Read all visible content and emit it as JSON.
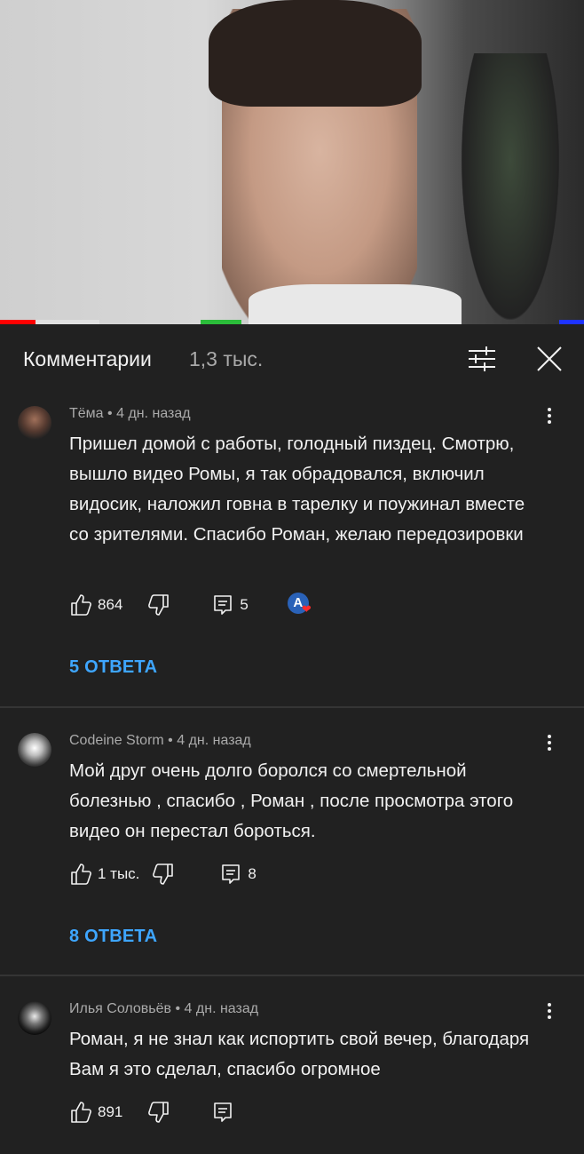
{
  "header": {
    "title": "Комментарии",
    "count": "1,3 тыс."
  },
  "comments": [
    {
      "author": "Тёма",
      "time": "4 дн. назад",
      "text": "Пришел домой с работы, голодный пиздец. Смотрю, вышло видео Ромы, я так обрадовался, включил видосик, наложил говна в тарелку и поужинал вместе со зрителями. Спасибо Роман, желаю передозировки",
      "likes": "864",
      "reply_count": "5",
      "replies_label": "5 ОТВЕТА",
      "creator_badge": "A"
    },
    {
      "author": "Codeine Storm",
      "time": "4 дн. назад",
      "text": "Мой друг очень долго боролся со смертельной болезнью , спасибо , Роман , после просмотра этого видео он перестал бороться.",
      "likes": "1 тыс.",
      "reply_count": "8",
      "replies_label": "8 ОТВЕТА"
    },
    {
      "author": "Илья Соловьёв",
      "time": "4 дн. назад",
      "text": "Роман, я не знал как испортить свой вечер, благодаря Вам я это сделал, спасибо огромное",
      "likes": "891"
    }
  ],
  "meta_separator": "•",
  "colors": {
    "background": "#212121",
    "link": "#3ea6ff",
    "progress_played": "#ff0000"
  }
}
